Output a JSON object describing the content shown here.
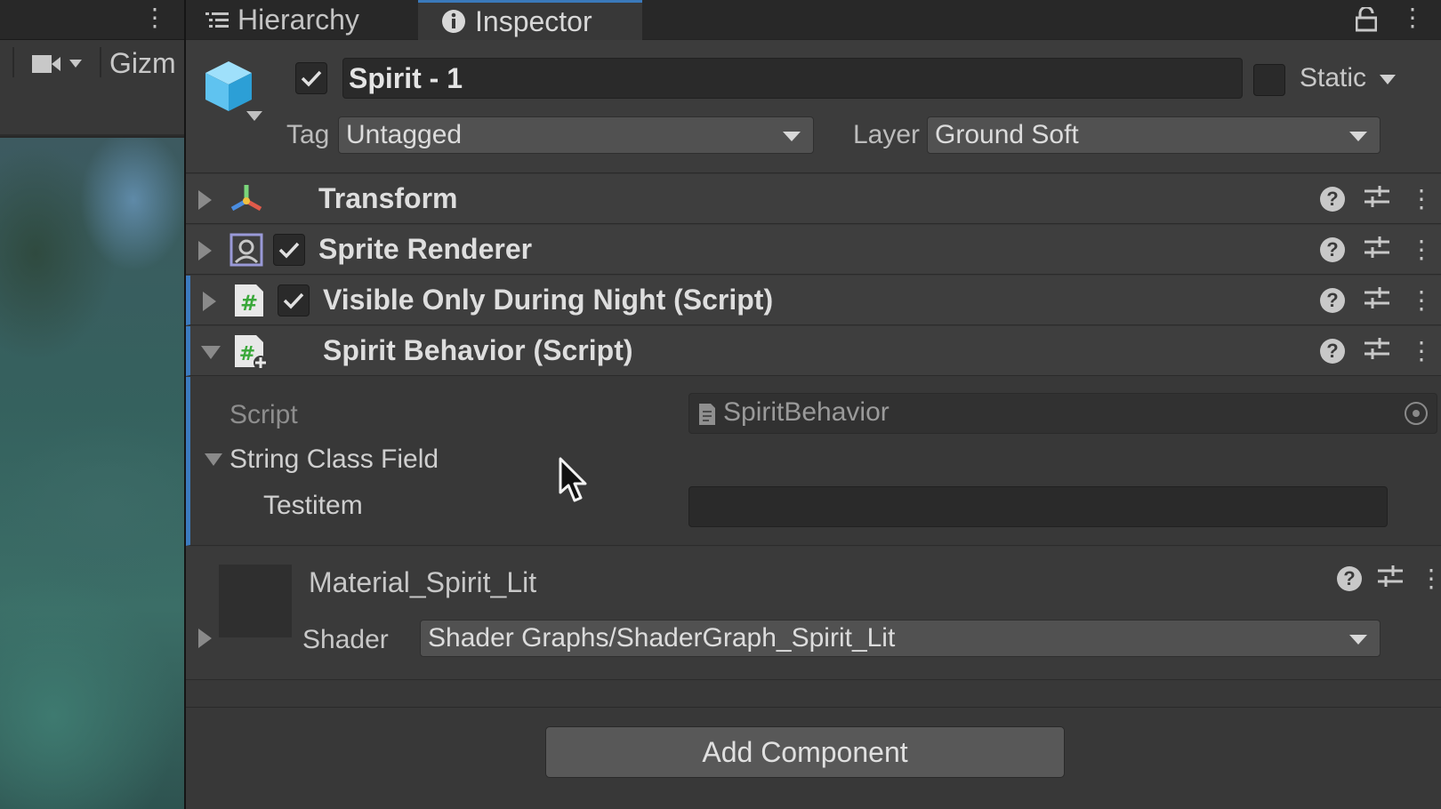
{
  "scene": {
    "gizmos_label": "Gizm"
  },
  "tabs": {
    "hierarchy": "Hierarchy",
    "inspector": "Inspector"
  },
  "gameobject": {
    "active": true,
    "name": "Spirit - 1",
    "static_label": "Static",
    "static": false,
    "tag_label": "Tag",
    "tag_value": "Untagged",
    "layer_label": "Layer",
    "layer_value": "Ground Soft"
  },
  "components": [
    {
      "title": "Transform",
      "icon": "transform-icon",
      "has_toggle": false,
      "expanded": false
    },
    {
      "title": "Sprite Renderer",
      "icon": "sprite-renderer-icon",
      "has_toggle": true,
      "enabled": true,
      "expanded": false
    },
    {
      "title": "Visible Only During Night (Script)",
      "icon": "script-icon",
      "has_toggle": true,
      "enabled": true,
      "expanded": false
    },
    {
      "title": "Spirit Behavior (Script)",
      "icon": "script-plus-icon",
      "has_toggle": false,
      "expanded": true
    }
  ],
  "spirit_behavior": {
    "script_label": "Script",
    "script_value": "SpiritBehavior",
    "string_class_field_label": "String Class Field",
    "testitem_label": "Testitem",
    "testitem_value": ""
  },
  "material": {
    "name": "Material_Spirit_Lit",
    "shader_label": "Shader",
    "shader_value": "Shader Graphs/ShaderGraph_Spirit_Lit"
  },
  "add_component_label": "Add Component",
  "colors": {
    "accent_blue": "#3c7bbf",
    "cube_blue": "#5fc3f0",
    "script_green": "#7ad67a"
  }
}
